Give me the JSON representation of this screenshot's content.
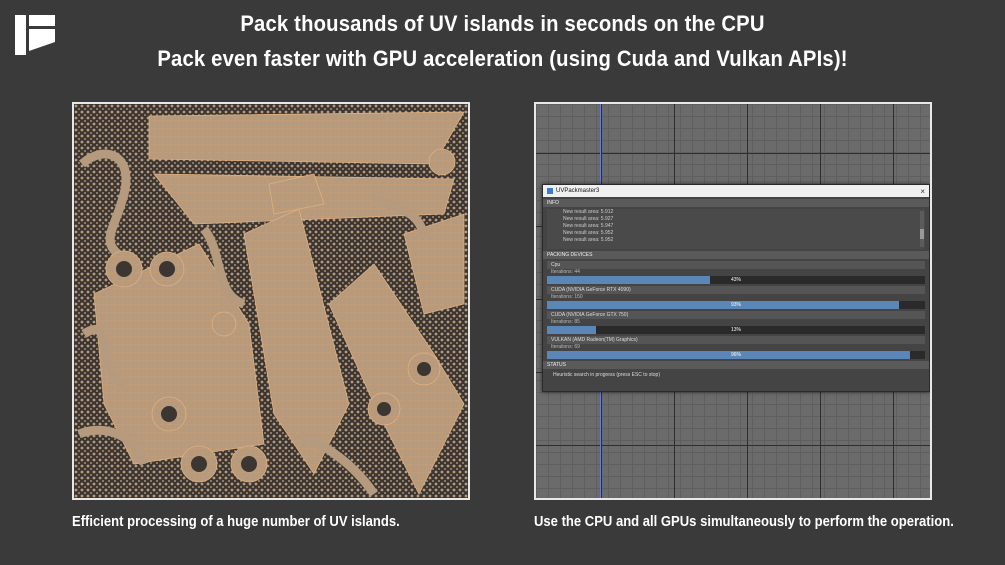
{
  "headline": {
    "line1": "Pack thousands of UV islands in seconds on the CPU",
    "line2": "Pack even faster with GPU acceleration (using Cuda and Vulkan APIs)!"
  },
  "captions": {
    "left": "Efficient processing of a huge number of UV islands.",
    "right": "Use the CPU and all GPUs simultaneously to perform the operation."
  },
  "colors": {
    "background": "#3a3a3a",
    "island": "#b99c80",
    "island_wire": "#e0a070",
    "progress_fill": "#5b87b8"
  },
  "dialog": {
    "title": "UVPackmaster3",
    "close_icon": "close-icon",
    "info_label": "INFO",
    "info_lines": [
      "New result area: 5.912",
      "New result area: 5.927",
      "New result area: 5.947",
      "New result area: 5.952",
      "New result area: 5.952"
    ],
    "devices_label": "PACKING DEVICES",
    "devices": [
      {
        "name": "Cpu",
        "iterations": "Iterations: 44",
        "progress": 0.43,
        "percent_label": "43%"
      },
      {
        "name": "CUDA (NVIDIA GeForce RTX 4090)",
        "iterations": "Iterations: 150",
        "progress": 0.93,
        "percent_label": "93%"
      },
      {
        "name": "CUDA (NVIDIA GeForce GTX 750)",
        "iterations": "Iterations: 85",
        "progress": 0.13,
        "percent_label": "13%"
      },
      {
        "name": "VULKAN (AMD Radeon(TM) Graphics)",
        "iterations": "Iterations: 69",
        "progress": 0.96,
        "percent_label": "96%"
      }
    ],
    "status_label": "STATUS",
    "status_text": "Heuristic search in progress (press ESC to stop)"
  }
}
